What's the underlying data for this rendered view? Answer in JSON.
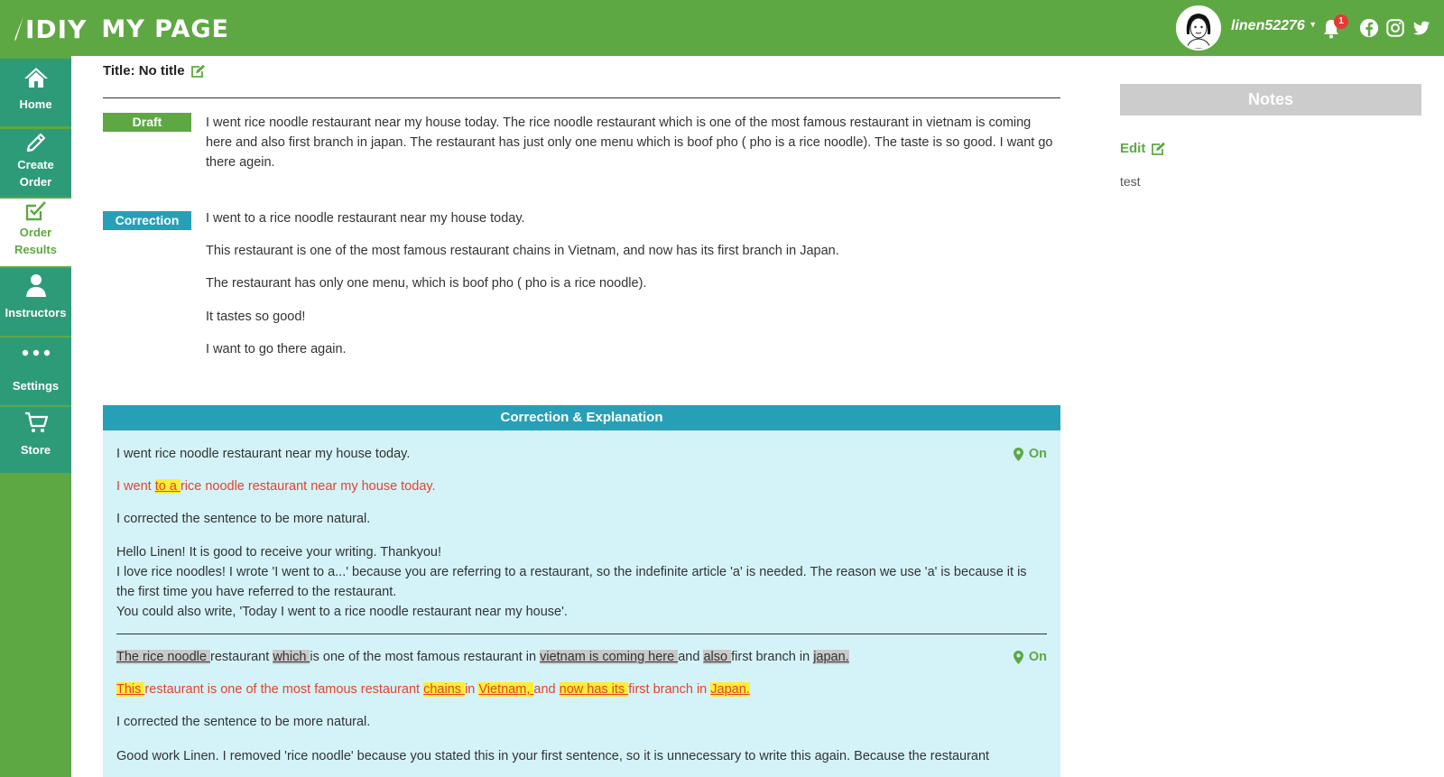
{
  "header": {
    "logo": "IDIY",
    "page_name": "MY PAGE",
    "username": "linen52276",
    "notification_count": "1",
    "colors": {
      "bar": "#5ea843",
      "badge": "#e53935"
    },
    "social_icons": [
      "facebook-icon",
      "instagram-icon",
      "twitter-icon"
    ]
  },
  "sidebar": {
    "items": [
      {
        "label_1": "Home",
        "label_2": "",
        "icon": "home-icon"
      },
      {
        "label_1": "Create",
        "label_2": "Order",
        "icon": "pencil-icon"
      },
      {
        "label_1": "Order",
        "label_2": "Results",
        "icon": "checkbox-icon",
        "active": true
      },
      {
        "label_1": "Instructors",
        "label_2": "",
        "icon": "person-icon"
      },
      {
        "label_1": "Settings",
        "label_2": "",
        "icon": "dots-icon"
      },
      {
        "label_1": "Store",
        "label_2": "",
        "icon": "cart-icon"
      }
    ]
  },
  "main": {
    "title": "Title: No title",
    "draft_tag": "Draft",
    "draft_text": "I went rice noodle restaurant near my house today. The rice noodle restaurant which is one of the most famous restaurant in vietnam is coming here and also first branch in japan. The restaurant has just only one menu which is boof pho ( pho is a rice noodle). The taste is so good. I want go there agein.",
    "correction_tag": "Correction",
    "correction_lines": [
      "I went to a rice noodle restaurant near my house today.",
      "This restaurant is one of the most famous restaurant chains in Vietnam, and now has its first branch in Japan.",
      "The restaurant has only one menu, which is boof pho ( pho is a rice noodle).",
      "It tastes so good!",
      "I want to go there again."
    ],
    "ce_header": "Correction & Explanation",
    "toggle_label": "On",
    "entry1": {
      "original": "I went rice noodle restaurant near my house today.",
      "corr_a": "I went ",
      "corr_hl": "to a ",
      "corr_b": "rice noodle restaurant near my house today.",
      "note": "I corrected the sentence to be more natural.",
      "exp_1": "Hello Linen! It is good to receive your writing. Thankyou!",
      "exp_2": "I love rice noodles! I wrote 'I went to a...' because you are referring to a restaurant, so the indefinite article 'a' is needed. The reason we use 'a' is because it is the first time you have referred to the restaurant.",
      "exp_3": "You could also write, 'Today I went to a rice noodle restaurant near my house'."
    },
    "entry2": {
      "o1": "The rice noodle ",
      "o2": "restaurant ",
      "o3": "which ",
      "o4": "is one of the most famous restaurant in ",
      "o5": "vietnam is coming here ",
      "o6": "and ",
      "o7": "also ",
      "o8": "first branch in ",
      "o9": "japan.",
      "c1": "This ",
      "c2": "restaurant is one of the most famous restaurant ",
      "c3": "chains ",
      "c4": "in ",
      "c5": "Vietnam, ",
      "c6": "and ",
      "c7": "now has its ",
      "c8": "first branch in ",
      "c9": "Japan.",
      "note": "I corrected the sentence to be more natural.",
      "exp_1": "Good work Linen. I removed 'rice noodle' because you stated this in your first sentence, so it is unnecessary to write this again. Because the restaurant"
    }
  },
  "notes": {
    "heading": "Notes",
    "edit_label": "Edit",
    "text": "test"
  }
}
